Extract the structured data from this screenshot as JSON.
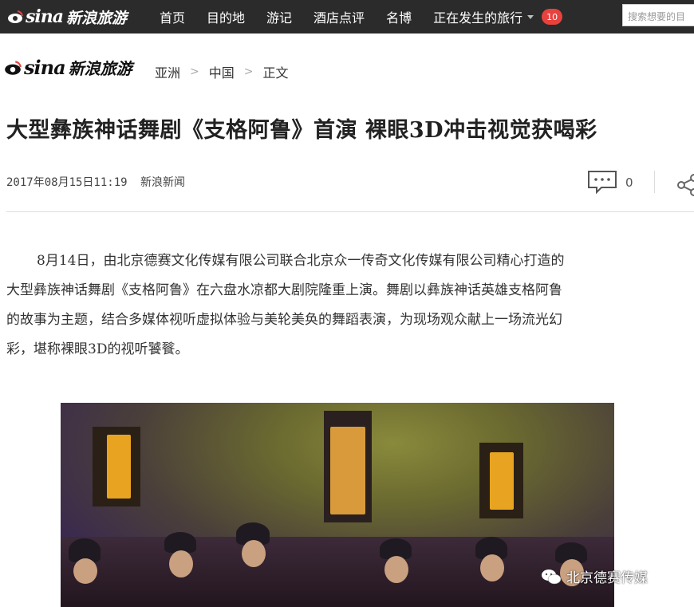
{
  "header": {
    "logo_brand": "sina",
    "logo_sub": "新浪旅游",
    "nav": [
      "首页",
      "目的地",
      "游记",
      "酒店点评",
      "名博"
    ],
    "trending_label": "正在发生的旅行",
    "trending_badge": "10",
    "search_placeholder": "搜索想要的目"
  },
  "breadcrumb": {
    "logo_brand": "sina",
    "logo_sub": "新浪旅游",
    "items": [
      "亚洲",
      "中国",
      "正文"
    ]
  },
  "article": {
    "title": "大型彝族神话舞剧《支格阿鲁》首演 裸眼3D冲击视觉获喝彩",
    "datetime": "2017年08月15日11:19",
    "source": "新浪新闻",
    "comment_count": "0",
    "body_lines": [
      "8月14日，由北京德赛文化传媒有限公司联合北京众一传奇文化传媒有限公司精心打造的",
      "大型彝族神话舞剧《支格阿鲁》在六盘水凉都大剧院隆重上演。舞剧以彝族神话英雄支格阿鲁",
      "的故事为主题，结合多媒体视听虚拟体验与美轮美奂的舞蹈表演，为现场观众献上一场流光幻",
      "彩，堪称裸眼3D的视听饕餮。"
    ]
  },
  "watermark": "北京德赛传媒",
  "icons": {
    "comment": "comment-icon",
    "share": "share-icon",
    "wechat": "wechat-icon",
    "sina_eye": "sina-eye-logo"
  },
  "colors": {
    "topbar": "#2b2b2b",
    "badge": "#e8423e"
  }
}
